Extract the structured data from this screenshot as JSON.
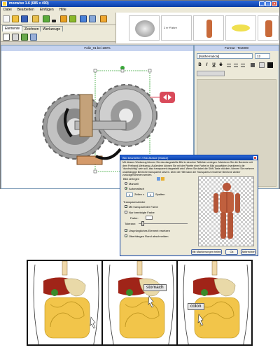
{
  "app": {
    "title": "moowisx 1.6 (685 x 490)",
    "controls": [
      "_",
      "□",
      "×"
    ]
  },
  "menu": [
    "Datei",
    "Bearbeiten",
    "Einfügen",
    "Hilfe"
  ],
  "tabs": [
    {
      "label": "Elemente",
      "active": true
    },
    {
      "label": "Zeichnen",
      "active": false
    },
    {
      "label": "Werkzeuge",
      "active": false
    }
  ],
  "thumbnails": [
    {
      "label": ""
    },
    {
      "label": "2 ● *Fahre"
    },
    {
      "label": ""
    },
    {
      "label": ""
    },
    {
      "label": ""
    }
  ],
  "canvas": {
    "header": "Folie_01 bei 100%"
  },
  "format_panel": {
    "header": "Format - Text000",
    "font": "[Mathematical]",
    "size": "12",
    "buttons": [
      "B",
      "I",
      "U",
      "S"
    ]
  },
  "dialog": {
    "title": "Bild bearbeiten / Bild-Maske (Maske)",
    "description": "Mit diesem Werkzeug können Sie das dargestellte Bild in einzelne Teilbilder zerlegen. Markieren Sie die Bereiche mit dem Freihand-Werkzeug. Außerdem können Sie mit der Pipette eine Farbe im Bild auswählen (markieren) die \"durchsichtig\" sein soll, also transparent dargestellt wird. Wenn Sie dabei die Shift-Taste drücken, können Sie mehrere unabhängige Bereiche transparent setzen. Über die Hilfe kann die Transparenz einzelner Bereiche wieder zurückgenommen werden.",
    "section_split": "Bild zerlegen",
    "opt_manual": "Manuell",
    "opt_auto": "Automatisch",
    "rows_value": "2",
    "rows_label": "Zeilen x",
    "cols_value": "2",
    "cols_label": "Spalten",
    "section_transparency": "Transparenzfarbe",
    "chk_transparent": "Mit transparenter Farbe",
    "chk_selected": "Nur bereinigte Farbe",
    "color_label": "Farbe:",
    "tolerance_label": "Toleranz:",
    "chk_original": "Ursprüngliches Element ersetzen",
    "chk_overhang": "Überhängen Rand abschneiden",
    "btn_preview": "Mit Markierungen teilen",
    "btn_ok": "Ok",
    "btn_cancel": "Abbrechen"
  },
  "panels": [
    {
      "tag": ""
    },
    {
      "tag": "stomach"
    },
    {
      "tag": "colon"
    }
  ],
  "colors": {
    "titlebar": "#0a3fa6",
    "chrome": "#ece9d8",
    "liver": "#a02418",
    "intestine": "#f2c54a",
    "selection": "#3aa83a"
  }
}
